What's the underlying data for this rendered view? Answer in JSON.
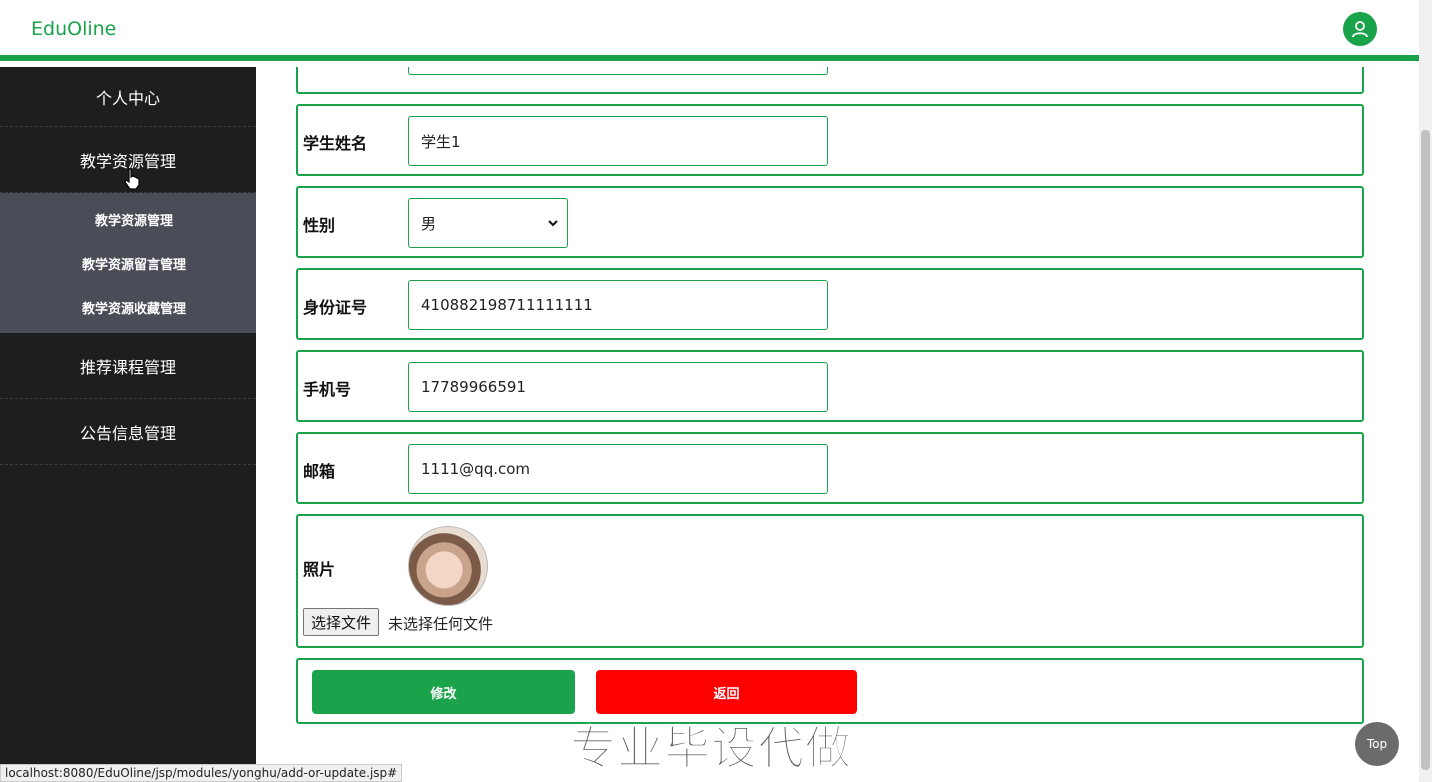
{
  "header": {
    "brand": "EduOline",
    "user_icon": "user-icon",
    "accent_color": "#1aa34a"
  },
  "sidebar": {
    "items": [
      {
        "label": "个人中心"
      },
      {
        "label": "教学资源管理"
      },
      {
        "label": "推荐课程管理"
      },
      {
        "label": "公告信息管理"
      }
    ],
    "submenu": [
      {
        "label": "教学资源管理"
      },
      {
        "label": "教学资源留言管理"
      },
      {
        "label": "教学资源收藏管理"
      }
    ]
  },
  "form": {
    "student_name": {
      "label": "学生姓名",
      "value": "学生1"
    },
    "gender": {
      "label": "性别",
      "value": "男"
    },
    "id_number": {
      "label": "身份证号",
      "value": "410882198711111111"
    },
    "phone": {
      "label": "手机号",
      "value": "17789966591"
    },
    "email": {
      "label": "邮箱",
      "value": "1111@qq.com"
    },
    "photo": {
      "label": "照片",
      "file_button": "选择文件",
      "file_status": "未选择任何文件"
    },
    "edit_button": "修改",
    "back_button": "返回"
  },
  "watermark": "专业毕设代做",
  "top_button": "Top",
  "status_url": "localhost:8080/EduOline/jsp/modules/yonghu/add-or-update.jsp#"
}
